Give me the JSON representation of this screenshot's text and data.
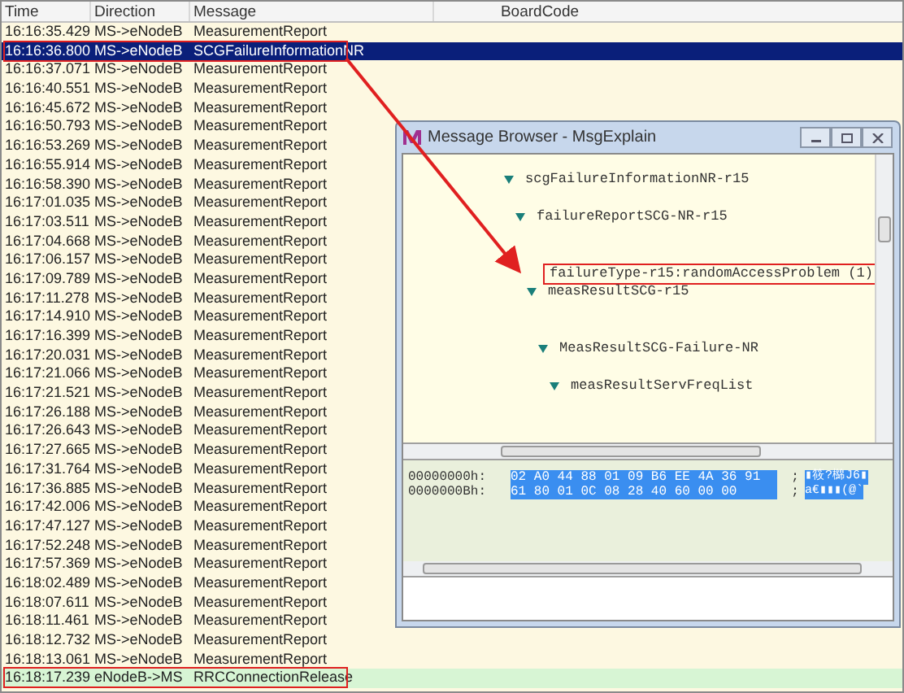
{
  "table": {
    "columns": [
      "Time",
      "Direction",
      "Message",
      "BoardCode"
    ],
    "rows": [
      {
        "time": "16:16:35.429",
        "direction": "MS->eNodeB",
        "message": "MeasurementReport",
        "selected": false,
        "outlined": false,
        "highlighted": false
      },
      {
        "time": "16:16:36.800",
        "direction": "MS->eNodeB",
        "message": "SCGFailureInformationNR",
        "selected": true,
        "outlined": true,
        "highlighted": false
      },
      {
        "time": "16:16:37.071",
        "direction": "MS->eNodeB",
        "message": "MeasurementReport",
        "selected": false,
        "outlined": false,
        "highlighted": false
      },
      {
        "time": "16:16:40.551",
        "direction": "MS->eNodeB",
        "message": "MeasurementReport",
        "selected": false,
        "outlined": false,
        "highlighted": false
      },
      {
        "time": "16:16:45.672",
        "direction": "MS->eNodeB",
        "message": "MeasurementReport",
        "selected": false,
        "outlined": false,
        "highlighted": false
      },
      {
        "time": "16:16:50.793",
        "direction": "MS->eNodeB",
        "message": "MeasurementReport",
        "selected": false,
        "outlined": false,
        "highlighted": false
      },
      {
        "time": "16:16:53.269",
        "direction": "MS->eNodeB",
        "message": "MeasurementReport",
        "selected": false,
        "outlined": false,
        "highlighted": false
      },
      {
        "time": "16:16:55.914",
        "direction": "MS->eNodeB",
        "message": "MeasurementReport",
        "selected": false,
        "outlined": false,
        "highlighted": false
      },
      {
        "time": "16:16:58.390",
        "direction": "MS->eNodeB",
        "message": "MeasurementReport",
        "selected": false,
        "outlined": false,
        "highlighted": false
      },
      {
        "time": "16:17:01.035",
        "direction": "MS->eNodeB",
        "message": "MeasurementReport",
        "selected": false,
        "outlined": false,
        "highlighted": false
      },
      {
        "time": "16:17:03.511",
        "direction": "MS->eNodeB",
        "message": "MeasurementReport",
        "selected": false,
        "outlined": false,
        "highlighted": false
      },
      {
        "time": "16:17:04.668",
        "direction": "MS->eNodeB",
        "message": "MeasurementReport",
        "selected": false,
        "outlined": false,
        "highlighted": false
      },
      {
        "time": "16:17:06.157",
        "direction": "MS->eNodeB",
        "message": "MeasurementReport",
        "selected": false,
        "outlined": false,
        "highlighted": false
      },
      {
        "time": "16:17:09.789",
        "direction": "MS->eNodeB",
        "message": "MeasurementReport",
        "selected": false,
        "outlined": false,
        "highlighted": false
      },
      {
        "time": "16:17:11.278",
        "direction": "MS->eNodeB",
        "message": "MeasurementReport",
        "selected": false,
        "outlined": false,
        "highlighted": false
      },
      {
        "time": "16:17:14.910",
        "direction": "MS->eNodeB",
        "message": "MeasurementReport",
        "selected": false,
        "outlined": false,
        "highlighted": false
      },
      {
        "time": "16:17:16.399",
        "direction": "MS->eNodeB",
        "message": "MeasurementReport",
        "selected": false,
        "outlined": false,
        "highlighted": false
      },
      {
        "time": "16:17:20.031",
        "direction": "MS->eNodeB",
        "message": "MeasurementReport",
        "selected": false,
        "outlined": false,
        "highlighted": false
      },
      {
        "time": "16:17:21.066",
        "direction": "MS->eNodeB",
        "message": "MeasurementReport",
        "selected": false,
        "outlined": false,
        "highlighted": false
      },
      {
        "time": "16:17:21.521",
        "direction": "MS->eNodeB",
        "message": "MeasurementReport",
        "selected": false,
        "outlined": false,
        "highlighted": false
      },
      {
        "time": "16:17:26.188",
        "direction": "MS->eNodeB",
        "message": "MeasurementReport",
        "selected": false,
        "outlined": false,
        "highlighted": false
      },
      {
        "time": "16:17:26.643",
        "direction": "MS->eNodeB",
        "message": "MeasurementReport",
        "selected": false,
        "outlined": false,
        "highlighted": false
      },
      {
        "time": "16:17:27.665",
        "direction": "MS->eNodeB",
        "message": "MeasurementReport",
        "selected": false,
        "outlined": false,
        "highlighted": false
      },
      {
        "time": "16:17:31.764",
        "direction": "MS->eNodeB",
        "message": "MeasurementReport",
        "selected": false,
        "outlined": false,
        "highlighted": false
      },
      {
        "time": "16:17:36.885",
        "direction": "MS->eNodeB",
        "message": "MeasurementReport",
        "selected": false,
        "outlined": false,
        "highlighted": false
      },
      {
        "time": "16:17:42.006",
        "direction": "MS->eNodeB",
        "message": "MeasurementReport",
        "selected": false,
        "outlined": false,
        "highlighted": false
      },
      {
        "time": "16:17:47.127",
        "direction": "MS->eNodeB",
        "message": "MeasurementReport",
        "selected": false,
        "outlined": false,
        "highlighted": false
      },
      {
        "time": "16:17:52.248",
        "direction": "MS->eNodeB",
        "message": "MeasurementReport",
        "selected": false,
        "outlined": false,
        "highlighted": false
      },
      {
        "time": "16:17:57.369",
        "direction": "MS->eNodeB",
        "message": "MeasurementReport",
        "selected": false,
        "outlined": false,
        "highlighted": false
      },
      {
        "time": "16:18:02.489",
        "direction": "MS->eNodeB",
        "message": "MeasurementReport",
        "selected": false,
        "outlined": false,
        "highlighted": false
      },
      {
        "time": "16:18:07.611",
        "direction": "MS->eNodeB",
        "message": "MeasurementReport",
        "selected": false,
        "outlined": false,
        "highlighted": false
      },
      {
        "time": "16:18:11.461",
        "direction": "MS->eNodeB",
        "message": "MeasurementReport",
        "selected": false,
        "outlined": false,
        "highlighted": false
      },
      {
        "time": "16:18:12.732",
        "direction": "MS->eNodeB",
        "message": "MeasurementReport",
        "selected": false,
        "outlined": false,
        "highlighted": false
      },
      {
        "time": "16:18:13.061",
        "direction": "MS->eNodeB",
        "message": "MeasurementReport",
        "selected": false,
        "outlined": false,
        "highlighted": false
      },
      {
        "time": "16:18:17.239",
        "direction": "eNodeB->MS",
        "message": "RRCConnectionRelease",
        "selected": false,
        "outlined": true,
        "highlighted": true
      }
    ]
  },
  "dialog": {
    "title": "Message Browser - MsgExplain",
    "tree": [
      {
        "label": "scgFailureInformationNR-r15",
        "expanded": true,
        "outlined": false,
        "children": [
          {
            "label": "failureReportSCG-NR-r15",
            "expanded": true,
            "outlined": false,
            "children": [
              {
                "label": "failureType-r15:randomAccessProblem (1)",
                "outlined": true
              },
              {
                "label": "measResultSCG-r15",
                "expanded": true,
                "outlined": false,
                "children": [
                  {
                    "label": "MeasResultSCG-Failure-NR",
                    "expanded": true,
                    "outlined": false,
                    "children": [
                      {
                        "label": "measResultServFreqList",
                        "expanded": true,
                        "outlined": false
                      }
                    ]
                  }
                ]
              }
            ]
          }
        ]
      }
    ],
    "hex": [
      {
        "offset": "00000000h:",
        "bytes": "02 A0 44 88 01 09 B6 EE 4A 36 91",
        "separator": ";",
        "ascii": "▮筱?檰J6▮"
      },
      {
        "offset": "0000000Bh:",
        "bytes": "61 80 01 0C 08 28 40 60 00 00",
        "separator": ";",
        "ascii": "a€▮▮▮(@`"
      }
    ]
  }
}
